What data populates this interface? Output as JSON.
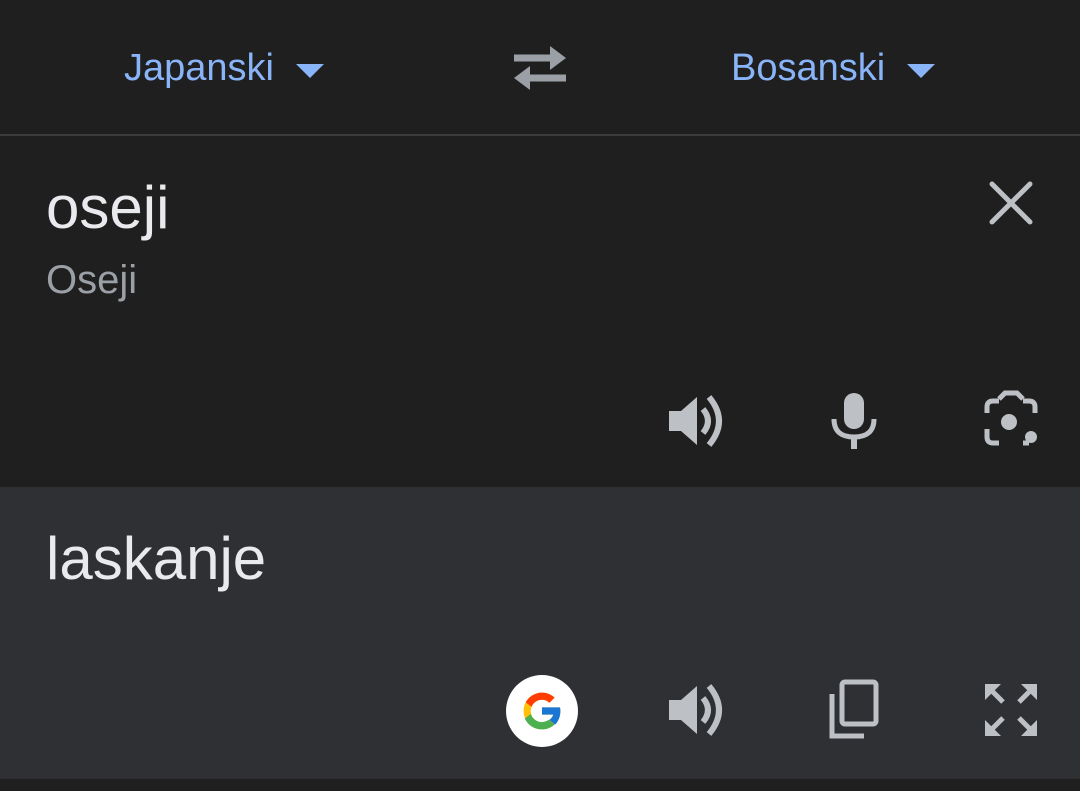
{
  "languages": {
    "source": "Japanski",
    "target": "Bosanski"
  },
  "input": {
    "text": "oseji",
    "transliteration": "Oseji"
  },
  "output": {
    "text": "laskanje"
  },
  "colors": {
    "accent": "#8ab4f8",
    "icon": "#bdc1c6",
    "background_top": "#1f1f1f",
    "background_output": "#2f3034"
  },
  "icons": {
    "swap": "swap-arrows-icon",
    "clear": "close-icon",
    "listen_source": "speaker-icon",
    "mic": "microphone-icon",
    "camera": "camera-lens-icon",
    "google": "google-logo-icon",
    "listen_target": "speaker-icon",
    "copy": "copy-icon",
    "fullscreen": "fullscreen-icon"
  }
}
